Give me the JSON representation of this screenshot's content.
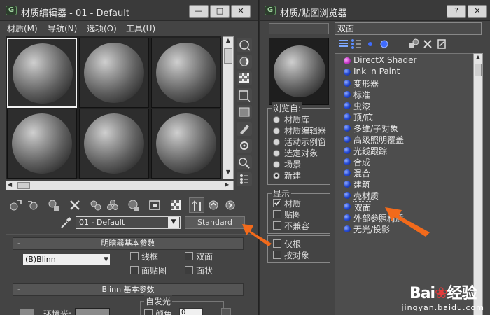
{
  "left_window": {
    "title": "材质编辑器 - 01 - Default",
    "buttons": {
      "minimize": "—",
      "maximize": "□",
      "close": "✕"
    },
    "menu": [
      "材质(M)",
      "导航(N)",
      "选项(O)",
      "工具(U)"
    ],
    "material_name": "01 - Default",
    "material_type_button": "Standard",
    "shader_rollout": {
      "header": "明暗器基本参数",
      "shader": "(B)Blinn",
      "options": [
        {
          "label": "线框",
          "checked": false
        },
        {
          "label": "双面",
          "checked": false
        },
        {
          "label": "面贴图",
          "checked": false
        },
        {
          "label": "面状",
          "checked": false
        }
      ]
    },
    "blinn_rollout": {
      "header": "Blinn 基本参数",
      "self_illum_group": "自发光",
      "ambient_label": "环境光:",
      "color_label": "颜色",
      "color_value": "0"
    },
    "icons": {
      "side_tools": [
        "sample-type-icon",
        "backlight-icon",
        "background-icon",
        "uv-tiling-icon",
        "video-color-check-icon",
        "make-preview-icon",
        "options-icon",
        "select-by-material-icon",
        "material-map-navigator-icon"
      ],
      "bottom_tools": [
        "get-material-icon",
        "put-to-scene-icon",
        "assign-to-selection-icon",
        "reset-map-icon",
        "make-copy-icon",
        "make-unique-icon",
        "put-to-library-icon",
        "material-effects-channel-icon",
        "show-map-in-viewport-icon",
        "show-end-result-icon",
        "go-to-parent-icon",
        "go-forward-to-sibling-icon"
      ]
    }
  },
  "right_window": {
    "title": "材质/贴图浏览器",
    "buttons": {
      "help": "?",
      "close": "✕"
    },
    "search_value": "双面",
    "browse_group": {
      "title": "浏览自:",
      "options": [
        {
          "label": "材质库",
          "selected": false
        },
        {
          "label": "材质编辑器",
          "selected": false
        },
        {
          "label": "活动示例窗",
          "selected": false
        },
        {
          "label": "选定对象",
          "selected": false
        },
        {
          "label": "场景",
          "selected": false
        },
        {
          "label": "新建",
          "selected": true
        }
      ]
    },
    "show_group": {
      "title": "显示",
      "options": [
        {
          "label": "材质",
          "checked": true
        },
        {
          "label": "贴图",
          "checked": false
        },
        {
          "label": "不兼容",
          "checked": false
        }
      ]
    },
    "extra_options": [
      {
        "label": "仅根",
        "checked": false
      },
      {
        "label": "按对象",
        "checked": false
      }
    ],
    "materials": [
      {
        "label": "DirectX Shader",
        "kind": "dx"
      },
      {
        "label": "Ink 'n Paint",
        "kind": "std"
      },
      {
        "label": "变形器",
        "kind": "std"
      },
      {
        "label": "标准",
        "kind": "std"
      },
      {
        "label": "虫漆",
        "kind": "std"
      },
      {
        "label": "顶/底",
        "kind": "std"
      },
      {
        "label": "多维/子对象",
        "kind": "std"
      },
      {
        "label": "高级照明覆盖",
        "kind": "std"
      },
      {
        "label": "光线跟踪",
        "kind": "std"
      },
      {
        "label": "合成",
        "kind": "std"
      },
      {
        "label": "混合",
        "kind": "std"
      },
      {
        "label": "建筑",
        "kind": "std"
      },
      {
        "label": "壳材质",
        "kind": "std"
      },
      {
        "label": "双面",
        "kind": "std",
        "selected": true
      },
      {
        "label": "外部参照材质",
        "kind": "std"
      },
      {
        "label": "无光/投影",
        "kind": "std"
      }
    ],
    "toolbar_icons": [
      "view-list-icon",
      "view-list-icons-icon",
      "view-small-icons-icon",
      "view-large-icons-icon",
      "update-scene-materials-icon",
      "delete-from-library-icon",
      "clear-material-library-icon"
    ]
  },
  "watermark": {
    "logo": "Bai经验",
    "logo_prefix": "Bai",
    "logo_suffix": "经验",
    "site": "jingyan.baidu.com"
  },
  "accent_colors": {
    "arrow": "#f26a1b",
    "selection_border": "#f2f2f2"
  }
}
